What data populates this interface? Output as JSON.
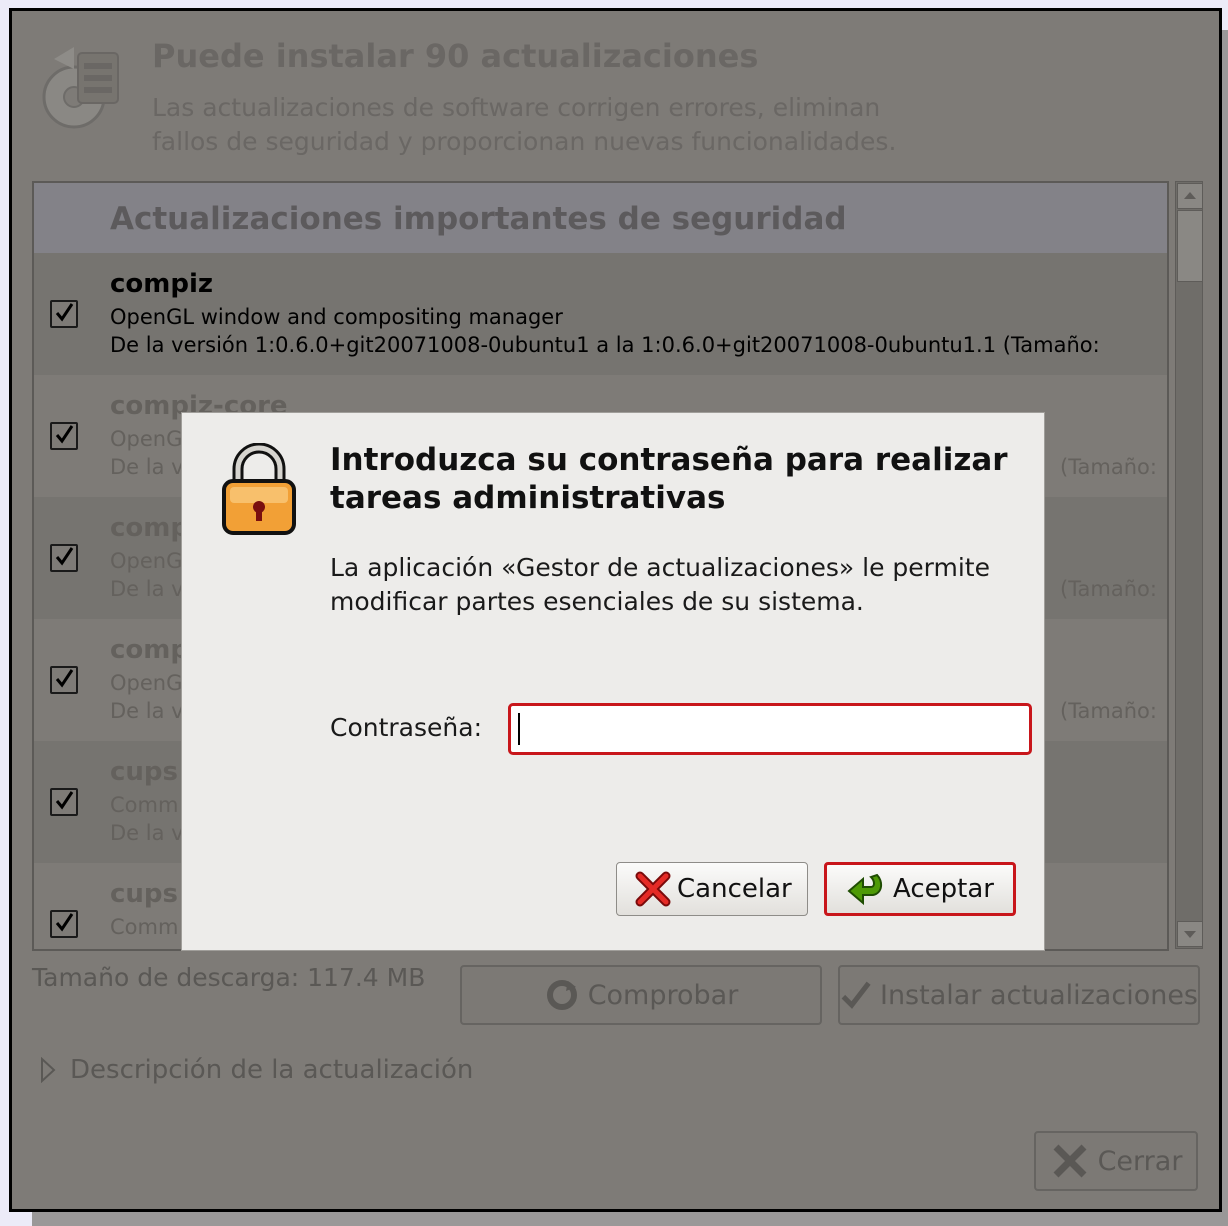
{
  "updater": {
    "title": "Puede instalar 90 actualizaciones",
    "subtitle_line1": "Las actualizaciones de software corrigen errores, eliminan",
    "subtitle_line2": "fallos de seguridad y proporcionan nuevas funcionalidades.",
    "section_header": "Actualizaciones importantes de seguridad",
    "packages": [
      {
        "name": "compiz",
        "description": "OpenGL window and compositing manager",
        "version": "De la versión 1:0.6.0+git20071008-0ubuntu1 a la 1:0.6.0+git20071008-0ubuntu1.1 (Tamaño:",
        "checked": true
      },
      {
        "name": "compiz-core",
        "description": "OpenG",
        "version": "De la v",
        "version_tail": "(Tamaño:",
        "checked": true
      },
      {
        "name": "comp",
        "description": "OpenG",
        "version": "De la v",
        "version_tail": "(Tamaño:",
        "checked": true
      },
      {
        "name": "comp",
        "description": "OpenG",
        "version": "De la v",
        "version_tail": "(Tamaño:",
        "checked": true
      },
      {
        "name": "cups",
        "description": "Comm",
        "version": "De la v",
        "checked": true
      },
      {
        "name": "cups",
        "description": "Comm",
        "version": "",
        "checked": true
      }
    ],
    "download_size": "Tamaño de descarga: 117.4 MB",
    "check_button": "Comprobar",
    "install_button": "Instalar actualizaciones",
    "expander_label": "Descripción de la actualización",
    "close_button": "Cerrar"
  },
  "dialog": {
    "title_line1": "Introduzca su contraseña para realizar",
    "title_line2": "tareas administrativas",
    "message_line1": "La aplicación «Gestor de actualizaciones» le permite",
    "message_line2": "modificar partes esenciales de su sistema.",
    "password_label": "Contraseña:",
    "password_value": "",
    "cancel_button": "Cancelar",
    "ok_button": "Aceptar"
  },
  "colors": {
    "accent_red": "#c8161b",
    "dim_overlay": "#7E7B77",
    "dialog_bg": "#EDECEA"
  }
}
